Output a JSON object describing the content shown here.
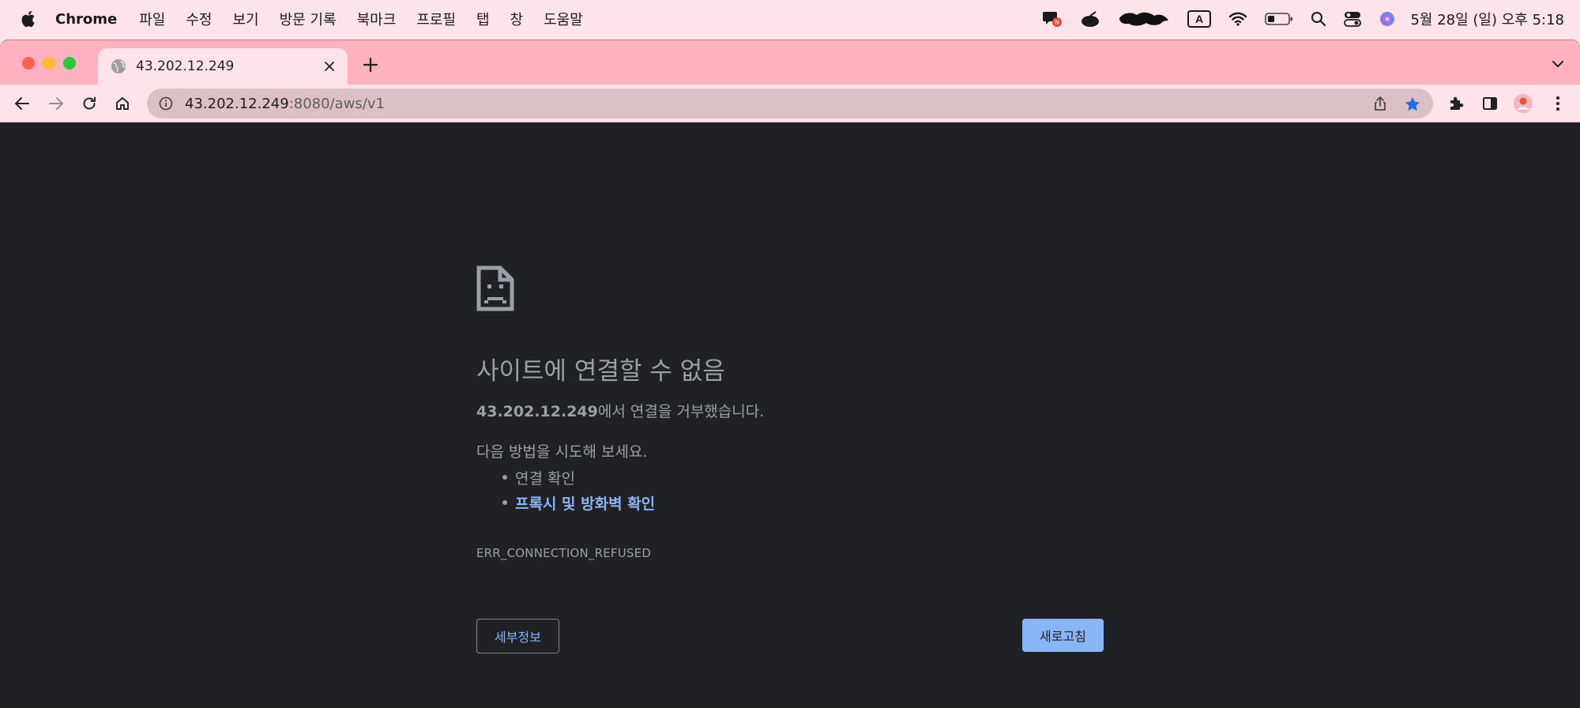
{
  "menubar": {
    "apple_icon": "apple-logo-icon",
    "app_name": "Chrome",
    "items": [
      "파일",
      "수정",
      "보기",
      "방문 기록",
      "북마크",
      "프로필",
      "탭",
      "창",
      "도움말"
    ],
    "status_icons": [
      "chat-notification-icon",
      "mouse-app-icon",
      "redacted-blob-icon",
      "input-source-icon",
      "wifi-icon",
      "battery-icon",
      "spotlight-search-icon",
      "control-center-icon",
      "siri-icon"
    ],
    "input_source_label": "A",
    "clock": "5월 28일 (일) 오후 5:18"
  },
  "browser": {
    "tab": {
      "title": "43.202.12.249",
      "favicon": "globe-icon"
    },
    "omnibox": {
      "host": "43.202.12.249",
      "path": ":8080/aws/v1"
    },
    "colors": {
      "tabstrip": "#ffb1bf",
      "toolbar": "#ffe3ea",
      "page_bg": "#202124",
      "link": "#8ab4f8",
      "text": "#9aa0a6"
    }
  },
  "error_page": {
    "icon": "sad-document-icon",
    "title": "사이트에 연결할 수 없음",
    "host": "43.202.12.249",
    "description": "에서 연결을 거부했습니다.",
    "try_text": "다음 방법을 시도해 보세요.",
    "suggestions": [
      {
        "text": "연결 확인"
      },
      {
        "text": "프록시 및 방화벽 확인"
      }
    ],
    "error_code": "ERR_CONNECTION_REFUSED",
    "details_button": "세부정보",
    "reload_button": "새로고침"
  }
}
